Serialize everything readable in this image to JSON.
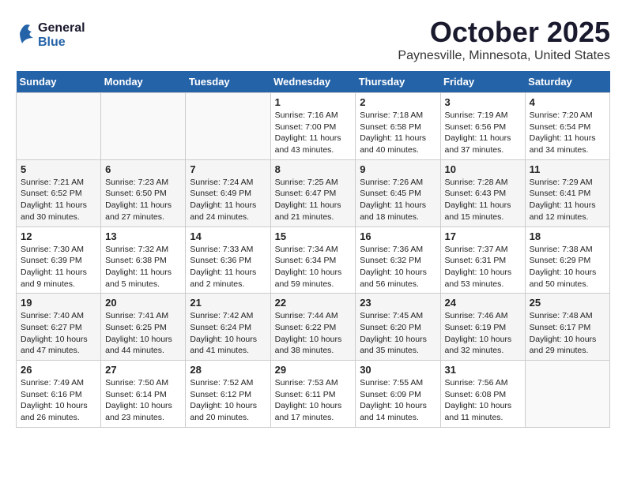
{
  "header": {
    "logo_general": "General",
    "logo_blue": "Blue",
    "month_title": "October 2025",
    "location": "Paynesville, Minnesota, United States"
  },
  "days_of_week": [
    "Sunday",
    "Monday",
    "Tuesday",
    "Wednesday",
    "Thursday",
    "Friday",
    "Saturday"
  ],
  "weeks": [
    [
      {
        "day": "",
        "info": ""
      },
      {
        "day": "",
        "info": ""
      },
      {
        "day": "",
        "info": ""
      },
      {
        "day": "1",
        "info": "Sunrise: 7:16 AM\nSunset: 7:00 PM\nDaylight: 11 hours\nand 43 minutes."
      },
      {
        "day": "2",
        "info": "Sunrise: 7:18 AM\nSunset: 6:58 PM\nDaylight: 11 hours\nand 40 minutes."
      },
      {
        "day": "3",
        "info": "Sunrise: 7:19 AM\nSunset: 6:56 PM\nDaylight: 11 hours\nand 37 minutes."
      },
      {
        "day": "4",
        "info": "Sunrise: 7:20 AM\nSunset: 6:54 PM\nDaylight: 11 hours\nand 34 minutes."
      }
    ],
    [
      {
        "day": "5",
        "info": "Sunrise: 7:21 AM\nSunset: 6:52 PM\nDaylight: 11 hours\nand 30 minutes."
      },
      {
        "day": "6",
        "info": "Sunrise: 7:23 AM\nSunset: 6:50 PM\nDaylight: 11 hours\nand 27 minutes."
      },
      {
        "day": "7",
        "info": "Sunrise: 7:24 AM\nSunset: 6:49 PM\nDaylight: 11 hours\nand 24 minutes."
      },
      {
        "day": "8",
        "info": "Sunrise: 7:25 AM\nSunset: 6:47 PM\nDaylight: 11 hours\nand 21 minutes."
      },
      {
        "day": "9",
        "info": "Sunrise: 7:26 AM\nSunset: 6:45 PM\nDaylight: 11 hours\nand 18 minutes."
      },
      {
        "day": "10",
        "info": "Sunrise: 7:28 AM\nSunset: 6:43 PM\nDaylight: 11 hours\nand 15 minutes."
      },
      {
        "day": "11",
        "info": "Sunrise: 7:29 AM\nSunset: 6:41 PM\nDaylight: 11 hours\nand 12 minutes."
      }
    ],
    [
      {
        "day": "12",
        "info": "Sunrise: 7:30 AM\nSunset: 6:39 PM\nDaylight: 11 hours\nand 9 minutes."
      },
      {
        "day": "13",
        "info": "Sunrise: 7:32 AM\nSunset: 6:38 PM\nDaylight: 11 hours\nand 5 minutes."
      },
      {
        "day": "14",
        "info": "Sunrise: 7:33 AM\nSunset: 6:36 PM\nDaylight: 11 hours\nand 2 minutes."
      },
      {
        "day": "15",
        "info": "Sunrise: 7:34 AM\nSunset: 6:34 PM\nDaylight: 10 hours\nand 59 minutes."
      },
      {
        "day": "16",
        "info": "Sunrise: 7:36 AM\nSunset: 6:32 PM\nDaylight: 10 hours\nand 56 minutes."
      },
      {
        "day": "17",
        "info": "Sunrise: 7:37 AM\nSunset: 6:31 PM\nDaylight: 10 hours\nand 53 minutes."
      },
      {
        "day": "18",
        "info": "Sunrise: 7:38 AM\nSunset: 6:29 PM\nDaylight: 10 hours\nand 50 minutes."
      }
    ],
    [
      {
        "day": "19",
        "info": "Sunrise: 7:40 AM\nSunset: 6:27 PM\nDaylight: 10 hours\nand 47 minutes."
      },
      {
        "day": "20",
        "info": "Sunrise: 7:41 AM\nSunset: 6:25 PM\nDaylight: 10 hours\nand 44 minutes."
      },
      {
        "day": "21",
        "info": "Sunrise: 7:42 AM\nSunset: 6:24 PM\nDaylight: 10 hours\nand 41 minutes."
      },
      {
        "day": "22",
        "info": "Sunrise: 7:44 AM\nSunset: 6:22 PM\nDaylight: 10 hours\nand 38 minutes."
      },
      {
        "day": "23",
        "info": "Sunrise: 7:45 AM\nSunset: 6:20 PM\nDaylight: 10 hours\nand 35 minutes."
      },
      {
        "day": "24",
        "info": "Sunrise: 7:46 AM\nSunset: 6:19 PM\nDaylight: 10 hours\nand 32 minutes."
      },
      {
        "day": "25",
        "info": "Sunrise: 7:48 AM\nSunset: 6:17 PM\nDaylight: 10 hours\nand 29 minutes."
      }
    ],
    [
      {
        "day": "26",
        "info": "Sunrise: 7:49 AM\nSunset: 6:16 PM\nDaylight: 10 hours\nand 26 minutes."
      },
      {
        "day": "27",
        "info": "Sunrise: 7:50 AM\nSunset: 6:14 PM\nDaylight: 10 hours\nand 23 minutes."
      },
      {
        "day": "28",
        "info": "Sunrise: 7:52 AM\nSunset: 6:12 PM\nDaylight: 10 hours\nand 20 minutes."
      },
      {
        "day": "29",
        "info": "Sunrise: 7:53 AM\nSunset: 6:11 PM\nDaylight: 10 hours\nand 17 minutes."
      },
      {
        "day": "30",
        "info": "Sunrise: 7:55 AM\nSunset: 6:09 PM\nDaylight: 10 hours\nand 14 minutes."
      },
      {
        "day": "31",
        "info": "Sunrise: 7:56 AM\nSunset: 6:08 PM\nDaylight: 10 hours\nand 11 minutes."
      },
      {
        "day": "",
        "info": ""
      }
    ]
  ]
}
